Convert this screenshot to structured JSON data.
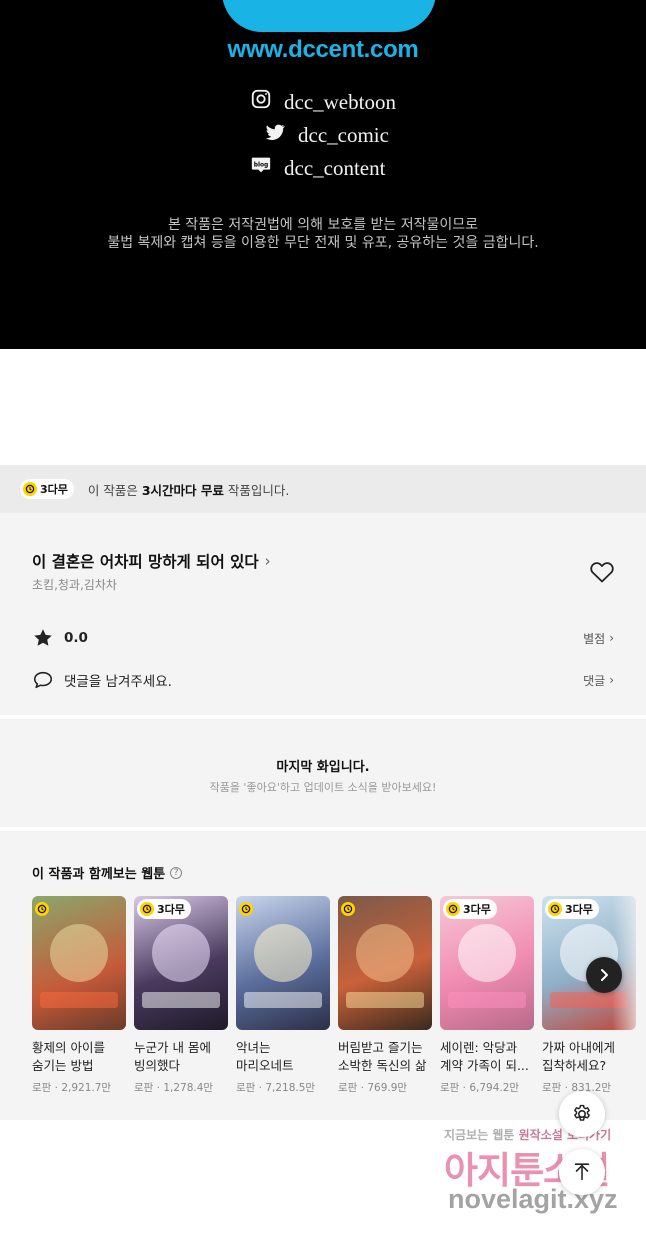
{
  "endcard": {
    "url": "www.dccent.com",
    "social": [
      {
        "icon": "instagram-icon",
        "label": "dcc_webtoon"
      },
      {
        "icon": "twitter-icon",
        "label": "dcc_comic"
      },
      {
        "icon": "blog-icon",
        "label": "dcc_content"
      }
    ],
    "copyright_line1": "본 작품은 저작권법에 의해 보호를 받는 저작물이므로",
    "copyright_line2": "불법 복제와 캡쳐 등을 이용한 무단 전재 및 유포, 공유하는 것을 금합니다."
  },
  "free_banner": {
    "badge": "3다무",
    "text_prefix": "이 작품은 ",
    "text_bold": "3시간마다 무료",
    "text_suffix": " 작품입니다."
  },
  "work": {
    "title": "이 결혼은 어차피 망하게 되어 있다",
    "authors": "초킴,청과,김차차",
    "rating": "0.0",
    "rating_link": "별점",
    "comment_prompt": "댓글을 남겨주세요.",
    "comment_link": "댓글"
  },
  "last_episode": {
    "heading": "마지막 화입니다.",
    "subtext": "작품을 '좋아요'하고 업데이트 소식을 받아보세요!"
  },
  "recommendations": {
    "title": "이 작품과 함께보는 웹툰",
    "help": "?",
    "items": [
      {
        "name": "황제의 아이를 숨기는 방법",
        "meta": "로판 · 2,921.7만",
        "badge": "",
        "has_clock": true
      },
      {
        "name": "누군가 내 몸에 빙의했다",
        "meta": "로판 · 1,278.4만",
        "badge": "3다무",
        "has_clock": true
      },
      {
        "name": "악녀는 마리오네트",
        "meta": "로판 · 7,218.5만",
        "badge": "",
        "has_clock": true
      },
      {
        "name": "버림받고 즐기는 소박한 독신의 삶",
        "meta": "로판 · 769.9만",
        "badge": "",
        "has_clock": true
      },
      {
        "name": "세이렌: 악당과 계약 가족이 되...",
        "meta": "로판 · 6,794.2만",
        "badge": "3다무",
        "has_clock": true
      },
      {
        "name": "가짜 아내에게 집착하세요?",
        "meta": "로판 · 831.2만",
        "badge": "3다무",
        "has_clock": true
      }
    ]
  },
  "watermark": {
    "line1_a": "지금보는 웹툰",
    "line1_b": "원작소설",
    "line1_c": "보러가기",
    "line2": "아지툰소설",
    "line3": "novelagit.xyz"
  },
  "colors": {
    "brand_blue": "#1ab3e6",
    "badge_yellow": "#ffd200",
    "panel_bg": "#f4f4f4"
  }
}
